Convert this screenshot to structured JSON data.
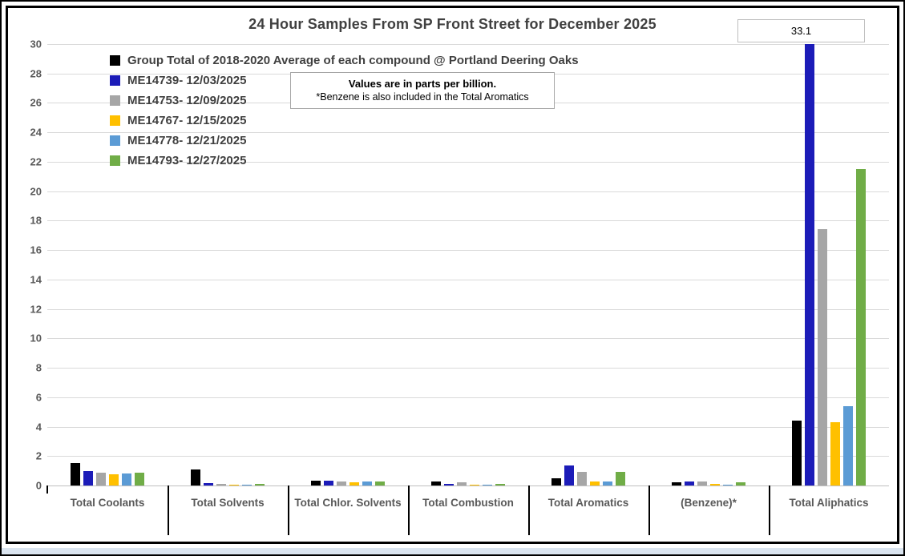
{
  "title": "24 Hour Samples From SP Front Street for December 2025",
  "note": {
    "line1": "Values are in parts per billion.",
    "line2": "*Benzene is also included in the Total Aromatics"
  },
  "annotation": {
    "value": "33.1"
  },
  "chart_data": {
    "type": "bar",
    "title": "24 Hour Samples From SP Front Street for December 2025",
    "units": "parts per billion",
    "categories": [
      "Total Coolants",
      "Total Solvents",
      "Total Chlor. Solvents",
      "Total Combustion",
      "Total Aromatics",
      "(Benzene)*",
      "Total Aliphatics"
    ],
    "series": [
      {
        "name": "Group Total of 2018-2020 Average of each compound @ Portland Deering Oaks",
        "color": "#000000",
        "values": [
          1.5,
          1.1,
          0.35,
          0.25,
          0.5,
          0.2,
          4.4
        ]
      },
      {
        "name": "ME14739- 12/03/2025",
        "color": "#1c1cb8",
        "values": [
          1.0,
          0.15,
          0.35,
          0.13,
          1.35,
          0.3,
          33.1
        ]
      },
      {
        "name": "ME14753- 12/09/2025",
        "color": "#a6a6a6",
        "values": [
          0.85,
          0.12,
          0.25,
          0.2,
          0.9,
          0.25,
          17.4
        ]
      },
      {
        "name": "ME14767- 12/15/2025",
        "color": "#ffc000",
        "values": [
          0.75,
          0.06,
          0.2,
          0.02,
          0.25,
          0.1,
          4.3
        ]
      },
      {
        "name": "ME14778- 12/21/2025",
        "color": "#5b9bd5",
        "values": [
          0.8,
          0.08,
          0.28,
          0.07,
          0.3,
          0.08,
          5.4
        ]
      },
      {
        "name": "ME14793- 12/27/2025",
        "color": "#70ad47",
        "values": [
          0.85,
          0.13,
          0.28,
          0.09,
          0.9,
          0.2,
          21.5
        ]
      }
    ],
    "ylim": [
      0,
      30
    ],
    "yticks": [
      0,
      2,
      4,
      6,
      8,
      10,
      12,
      14,
      16,
      18,
      20,
      22,
      24,
      26,
      28,
      30
    ],
    "grid": true,
    "legend_position": "top-left",
    "clipped_bar_label": {
      "series": "ME14739- 12/03/2025",
      "category": "Total Aliphatics",
      "value": 33.1
    },
    "colors": {
      "grid": "#d9d9d9",
      "axis": "#bfbfbf",
      "label_text": "#595959",
      "title_text": "#404040"
    }
  }
}
